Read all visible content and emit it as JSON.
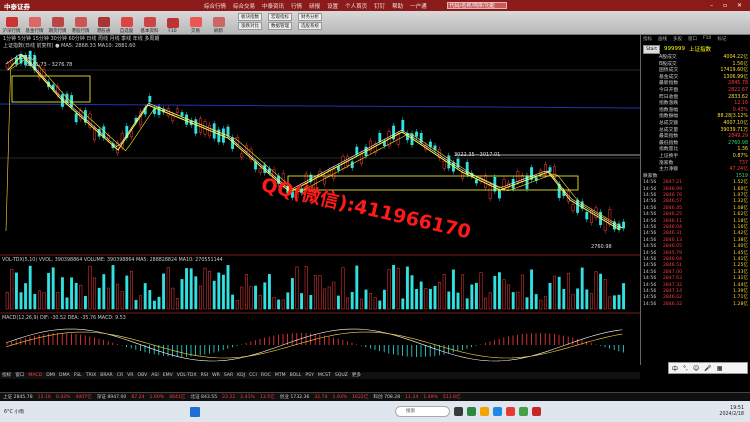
{
  "app": {
    "logo": "中泰证券",
    "menu": [
      "综合行情",
      "综合交易",
      "中泰资讯",
      "行情",
      "研报",
      "设置",
      "个人首页",
      "钉钉",
      "帮助",
      "一户通"
    ],
    "search_placeholder": "代码/名称/简拼/功能"
  },
  "toolbar": {
    "buttons": [
      "沪深行情",
      "基金行情",
      "期货行情",
      "港股行情",
      "港股通",
      "自选股",
      "基本资料",
      "F10",
      "交易",
      "刷新"
    ],
    "panel": [
      "板块指数",
      "宏观指标",
      "财务分析",
      "涨跌对比",
      "数据管理",
      "选股系统"
    ]
  },
  "chart_header": "上证指数(日线 前复权)  ● MA5: 2868.33  MA10: 2881.60",
  "period_tabs": "1分钟 5分钟 15分钟 30分钟 60分钟 日线 周线 月线 季线 年线 多周期",
  "price_labels": {
    "high": "3322.1",
    "zone1": "3281.73 - 3276.78",
    "zone2": "3022.35 - 3017.01",
    "low": "2760.98"
  },
  "watermark": "QQ(微信):411966170",
  "vol_header": "VOL-TDX(5,10) VVOL: 390398864  VOLUME: 390398864  MA5: 288828824  MA10: 270551144",
  "macd_header": "MACD(12,26,9) DIF: -30.52  DEA: -35.76  MACD: 9.53",
  "indicator_tabs": [
    "指标",
    "窗口",
    "MACD",
    "DMI",
    "DMA",
    "FSL",
    "TRIX",
    "BRAR",
    "CR",
    "VR",
    "OBV",
    "ASI",
    "EMV",
    "VOL-TDX",
    "RSI",
    "WR",
    "SAR",
    "KDJ",
    "CCI",
    "ROC",
    "MTM",
    "BOLL",
    "PSY",
    "MCST",
    "SQUZ",
    "更多"
  ],
  "right": {
    "tabs": [
      "指标",
      "画线",
      "多股",
      "窗口",
      "F10",
      "标记"
    ],
    "start_label": "Start",
    "code": "999999",
    "name": "上证指数",
    "stats": [
      {
        "k": "A股成交",
        "v": "4004.22亿",
        "c": "yel"
      },
      {
        "k": "B股成交",
        "v": "1.56亿",
        "c": "yel"
      },
      {
        "k": "国债成交",
        "v": "17419.60亿",
        "c": "yel"
      },
      {
        "k": "基金成交",
        "v": "1306.99亿",
        "c": "yel"
      },
      {
        "k": "最新指数",
        "v": "2845.78",
        "c": "red"
      },
      {
        "k": "今日开盘",
        "v": "2822.67",
        "c": "red"
      },
      {
        "k": "昨日收盘",
        "v": "2833.62",
        "c": "yel"
      },
      {
        "k": "指数涨跌",
        "v": "12.16",
        "c": "red"
      },
      {
        "k": "指数涨幅",
        "v": "0.43%",
        "c": "red"
      },
      {
        "k": "指数振幅",
        "v": "88.28|3.12%",
        "c": "yel"
      },
      {
        "k": "总成交额",
        "v": "4007.10亿",
        "c": "yel"
      },
      {
        "k": "总成交量",
        "v": "39039.71万",
        "c": "yel"
      },
      {
        "k": "最高指数",
        "v": "2849.29",
        "c": "red"
      },
      {
        "k": "最低指数",
        "v": "2760.98",
        "c": "grn"
      },
      {
        "k": "指数量比",
        "v": "1.36",
        "c": "yel"
      },
      {
        "k": "上证换手",
        "v": "0.87%",
        "c": "yel"
      },
      {
        "k": "涨家数",
        "v": "737",
        "c": "red"
      },
      {
        "k": "主力净额",
        "v": "47.24亿",
        "c": "red"
      }
    ],
    "updown": {
      "down_label": "跌家数",
      "down": "1519",
      "same": "平家数"
    },
    "ticks": [
      {
        "t": "14:56",
        "p": "2847.21",
        "v": "1.52亿",
        "c": "red"
      },
      {
        "t": "14:56",
        "p": "2846.99",
        "v": "1.60亿",
        "c": "red"
      },
      {
        "t": "14:56",
        "p": "2846.76",
        "v": "1.07亿",
        "c": "red"
      },
      {
        "t": "14:56",
        "p": "2846.57",
        "v": "1.32亿",
        "c": "red"
      },
      {
        "t": "14:56",
        "p": "2846.45",
        "v": "1.08亿",
        "c": "red"
      },
      {
        "t": "14:56",
        "p": "2846.25",
        "v": "1.62亿",
        "c": "red"
      },
      {
        "t": "14:56",
        "p": "2846.11",
        "v": "1.18亿",
        "c": "red"
      },
      {
        "t": "14:56",
        "p": "2846.04",
        "v": "1.16亿",
        "c": "red"
      },
      {
        "t": "14:56",
        "p": "2846.31",
        "v": "1.42亿",
        "c": "red"
      },
      {
        "t": "14:56",
        "p": "2846.13",
        "v": "1.38亿",
        "c": "red"
      },
      {
        "t": "14:56",
        "p": "2846.05",
        "v": "1.40亿",
        "c": "red"
      },
      {
        "t": "14:56",
        "p": "2845.79",
        "v": "1.45亿",
        "c": "red"
      },
      {
        "t": "14:56",
        "p": "2846.04",
        "v": "1.41亿",
        "c": "red"
      },
      {
        "t": "14:56",
        "p": "2846.51",
        "v": "1.25亿",
        "c": "red"
      },
      {
        "t": "14:56",
        "p": "2847.00",
        "v": "1.33亿",
        "c": "red"
      },
      {
        "t": "14:56",
        "p": "2847.63",
        "v": "1.31亿",
        "c": "red"
      },
      {
        "t": "14:56",
        "p": "2847.32",
        "v": "1.44亿",
        "c": "red"
      },
      {
        "t": "14:56",
        "p": "2847.14",
        "v": "1.39亿",
        "c": "red"
      },
      {
        "t": "14:56",
        "p": "2846.62",
        "v": "1.71亿",
        "c": "red"
      },
      {
        "t": "14:56",
        "p": "2846.32",
        "v": "1.28亿",
        "c": "red"
      }
    ]
  },
  "statusbar": [
    "上证 2845.78",
    "12.16",
    "0.43%",
    "4007亿",
    "深证 8947.00",
    "87.24",
    "1.00%",
    "4641亿",
    "北证 843.55",
    "22.22",
    "2.41%",
    "13.5亿",
    "创业 1732.36",
    "32.74",
    "1.93%",
    "1622亿",
    "科创 708.28",
    "11.24",
    "1.49%",
    "511.6亿"
  ],
  "taskbar": {
    "weather": "6°C 小雨",
    "search": "搜索",
    "time": "19:51",
    "date": "2024/2/18"
  }
}
